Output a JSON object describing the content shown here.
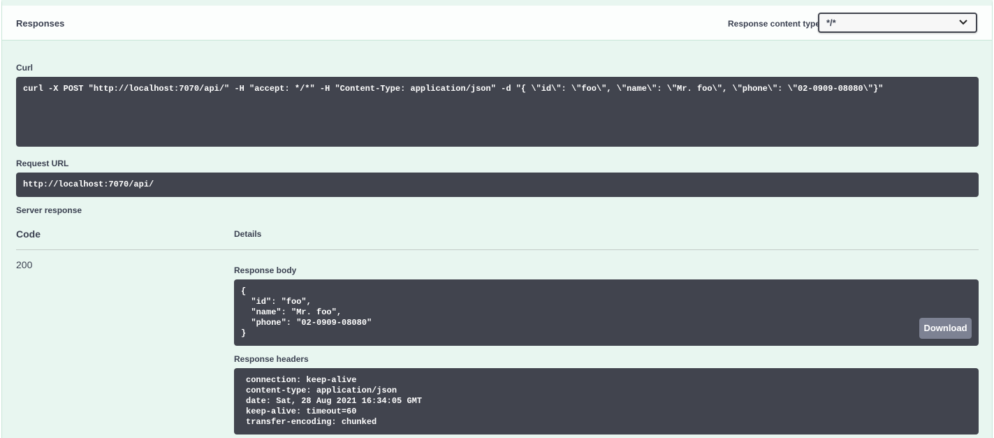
{
  "responses": {
    "title": "Responses",
    "content_type_label": "Response content type",
    "content_type_value": "*/*"
  },
  "curl": {
    "label": "Curl",
    "command": "curl -X POST \"http://localhost:7070/api/\" -H \"accept: */*\" -H \"Content-Type: application/json\" -d \"{ \\\"id\\\": \\\"foo\\\", \\\"name\\\": \\\"Mr. foo\\\", \\\"phone\\\": \\\"02-0909-08080\\\"}\""
  },
  "request_url": {
    "label": "Request URL",
    "value": "http://localhost:7070/api/"
  },
  "server_response": {
    "label": "Server response",
    "col_code": "Code",
    "col_details": "Details",
    "status_code": "200",
    "response_body_label": "Response body",
    "response_body": "{\n  \"id\": \"foo\",\n  \"name\": \"Mr. foo\",\n  \"phone\": \"02-0909-08080\"\n}",
    "download_label": "Download",
    "response_headers_label": "Response headers",
    "response_headers": "connection: keep-alive\ncontent-type: application/json\ndate: Sat, 28 Aug 2021 16:34:05 GMT\nkeep-alive: timeout=60\ntransfer-encoding: chunked"
  },
  "icons": {
    "select_chevron": "chevron-down-icon"
  },
  "colors": {
    "panel_bg": "#e8f6f0",
    "code_bg": "#41444e",
    "button_bg": "#7d8293",
    "text": "#3b4151"
  }
}
